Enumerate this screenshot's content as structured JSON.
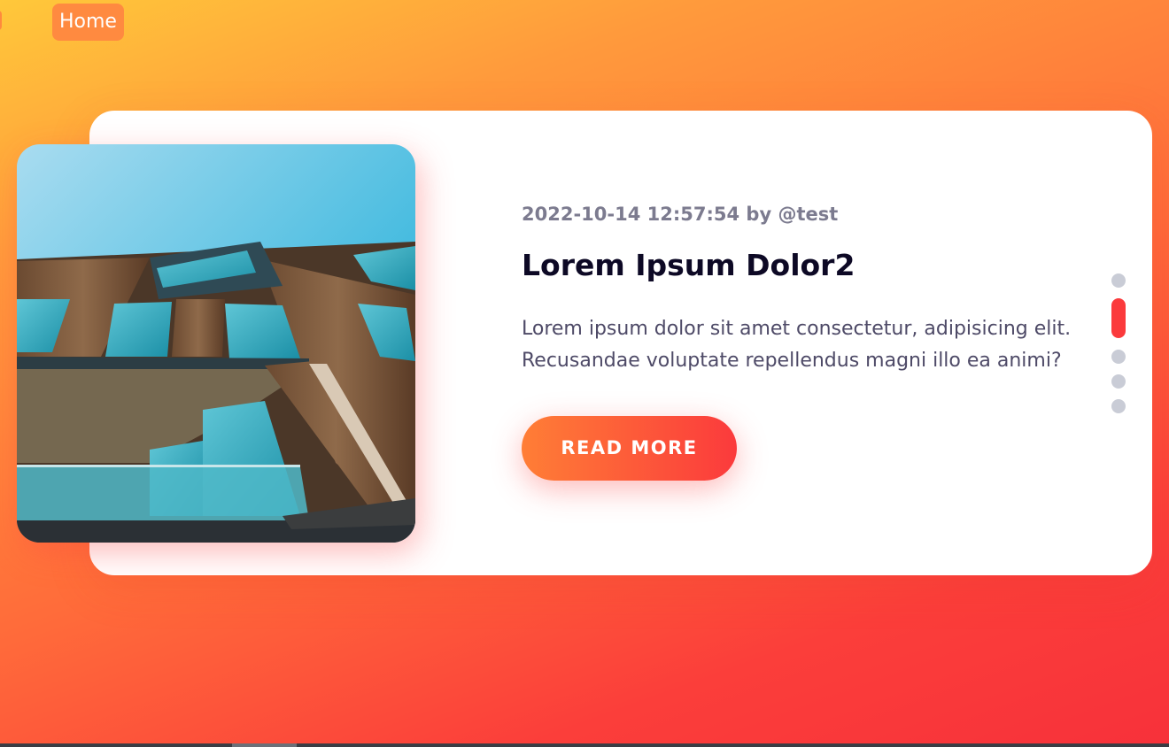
{
  "nav": {
    "home_label": "Home"
  },
  "post": {
    "meta": "2022-10-14 12:57:54 by @test",
    "title": "Lorem Ipsum Dolor2",
    "description": "Lorem ipsum dolor sit amet consectetur, adipisicing elit. Recusandae voluptate repellendus magni illo ea animi?",
    "read_more_label": "READ MORE",
    "image_icon": "building-photo"
  },
  "slider": {
    "total": 5,
    "active_index": 1
  },
  "colors": {
    "accent_red": "#fb3a3c",
    "accent_orange": "#ff7e36",
    "title": "#0d0925",
    "meta": "#7c7b8f",
    "body_text": "#4e4a67",
    "dot_inactive": "#c9ccd6"
  }
}
